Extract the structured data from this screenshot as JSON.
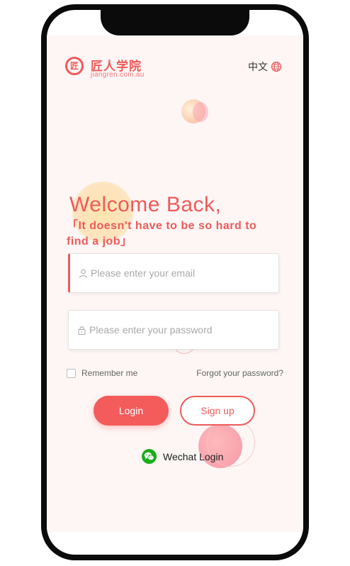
{
  "header": {
    "logo_mark": "匠",
    "logo_name": "匠人学院",
    "logo_url": "jiangren.com.au",
    "lang_label": "中文"
  },
  "title": "Welcome Back,",
  "subtitle": "「It doesn't have to be so hard to find a job」",
  "form": {
    "email_placeholder": "Please enter your email",
    "password_placeholder": "Please enter your password",
    "remember_label": "Remember me",
    "remember_checked": false,
    "forgot_label": "Forgot your password?"
  },
  "buttons": {
    "login_label": "Login",
    "signup_label": "Sign up"
  },
  "wechat": {
    "label": "Wechat Login"
  },
  "icons": {
    "globe": "globe-icon",
    "user": "user-icon",
    "lock": "lock-icon",
    "wechat": "wechat-icon"
  },
  "colors": {
    "accent": "#ee5b5b",
    "wechat": "#1aad19",
    "background": "#fdf6f5"
  }
}
